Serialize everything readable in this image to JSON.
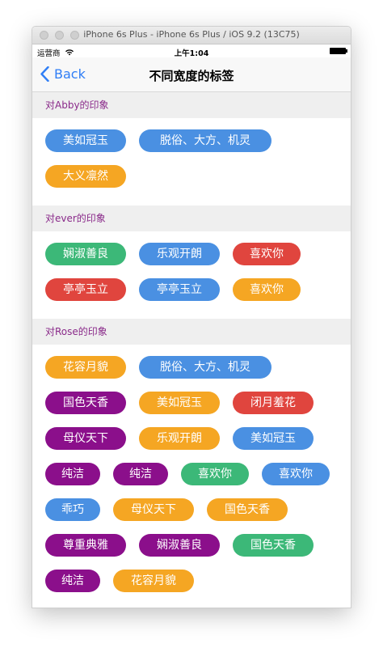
{
  "window": {
    "title": "iPhone 6s Plus - iPhone 6s Plus / iOS 9.2 (13C75)"
  },
  "status": {
    "carrier": "运营商",
    "time": "上午1:04"
  },
  "nav": {
    "back_label": "Back",
    "title": "不同宽度的标签"
  },
  "colors": {
    "blue": "#4a90e2",
    "orange": "#f5a623",
    "green": "#3cb878",
    "red": "#e0453e",
    "purple": "#8b0f8b"
  },
  "sections": [
    {
      "header": "对Abby的印象",
      "rows": [
        [
          {
            "text": "美如冠玉",
            "color": "blue"
          },
          {
            "text": "脱俗、大方、机灵",
            "color": "blue"
          }
        ],
        [
          {
            "text": "大义凛然",
            "color": "orange"
          }
        ]
      ]
    },
    {
      "header": "对ever的印象",
      "rows": [
        [
          {
            "text": "娴淑善良",
            "color": "green"
          },
          {
            "text": "乐观开朗",
            "color": "blue"
          },
          {
            "text": "喜欢你",
            "color": "red"
          }
        ],
        [
          {
            "text": "亭亭玉立",
            "color": "red"
          },
          {
            "text": "亭亭玉立",
            "color": "blue"
          },
          {
            "text": "喜欢你",
            "color": "orange"
          }
        ]
      ]
    },
    {
      "header": "对Rose的印象",
      "rows": [
        [
          {
            "text": "花容月貌",
            "color": "orange"
          },
          {
            "text": "脱俗、大方、机灵",
            "color": "blue"
          }
        ],
        [
          {
            "text": "国色天香",
            "color": "purple"
          },
          {
            "text": "美如冠玉",
            "color": "orange"
          },
          {
            "text": "闭月羞花",
            "color": "red"
          }
        ],
        [
          {
            "text": "母仪天下",
            "color": "purple"
          },
          {
            "text": "乐观开朗",
            "color": "orange"
          },
          {
            "text": "美如冠玉",
            "color": "blue"
          }
        ],
        [
          {
            "text": "纯洁",
            "color": "purple"
          },
          {
            "text": "纯洁",
            "color": "purple"
          },
          {
            "text": "喜欢你",
            "color": "green"
          },
          {
            "text": "喜欢你",
            "color": "blue"
          }
        ],
        [
          {
            "text": "乖巧",
            "color": "blue"
          },
          {
            "text": "母仪天下",
            "color": "orange"
          },
          {
            "text": "国色天香",
            "color": "orange"
          }
        ],
        [
          {
            "text": "尊重典雅",
            "color": "purple"
          },
          {
            "text": "娴淑善良",
            "color": "purple"
          },
          {
            "text": "国色天香",
            "color": "green"
          }
        ],
        [
          {
            "text": "纯洁",
            "color": "purple"
          },
          {
            "text": "花容月貌",
            "color": "orange"
          }
        ]
      ]
    }
  ]
}
